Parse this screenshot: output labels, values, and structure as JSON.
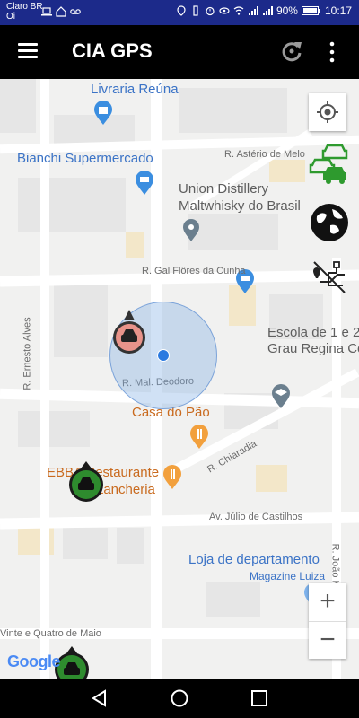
{
  "status_bar": {
    "carrier_line1": "Claro BR",
    "carrier_line2": "Oi",
    "battery": "90%",
    "time": "10:17"
  },
  "app_bar": {
    "title": "CIA GPS"
  },
  "map": {
    "pois": {
      "livraria": "Livraria Reúna",
      "bianchi": "Bianchi Supermercado",
      "union_line1": "Union Distillery",
      "union_line2": "Maltwhisky do Brasil",
      "escola_line1": "Escola de 1 e 2",
      "escola_line2": "Grau Regina Co",
      "casa_do_pao": "Casa do Pão",
      "ebba_line1": "EBBA Restaurante",
      "ebba_line2": "Lancheria",
      "loja_line1": "Loja de departamento",
      "loja_line2": "Magazine Luiza"
    },
    "streets": {
      "asterio": "R. Astério de Melo",
      "gal_flores": "R. Gal Flôres da Cunha",
      "ernesto": "R. Ernesto Alves",
      "mal_deodoro": "R. Mal. Deodoro",
      "chiaradia": "R. Chiaradia",
      "julio": "Av. Júlio de Castilhos",
      "joao": "R. João Missaglia",
      "vinte": "Vinte e Quatro de Maio"
    },
    "attribution": "Google",
    "zoom_in": "+",
    "zoom_out": "−",
    "colors": {
      "accent_blue": "#3b73c6",
      "vehicle_active": "#e8938a",
      "vehicle_ok": "#2e8b2e"
    }
  }
}
